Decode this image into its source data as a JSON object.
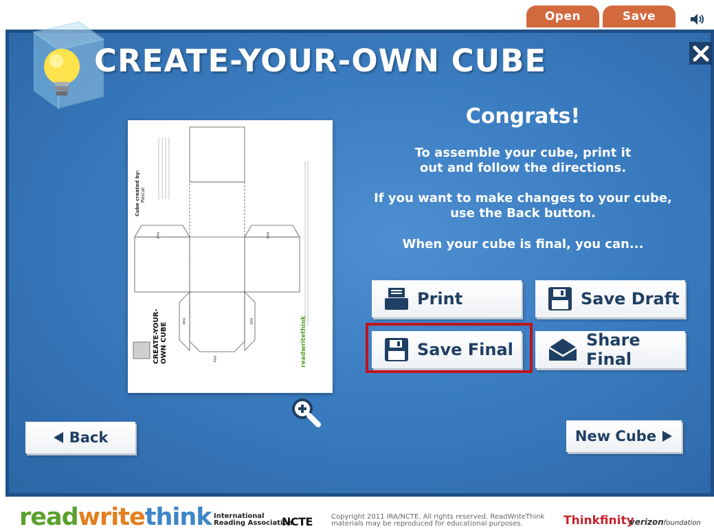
{
  "top_tabs": {
    "open_label": "Open",
    "save_label": "Save"
  },
  "title": "CREATE-YOUR-OWN CUBE",
  "preview": {
    "created_by_label": "Cube created by:",
    "author": "Pascal",
    "instructions": "Cut along the outside edges of your Cube. Then, fold along the dotted lines, making sure that your typed information stays on the outside. Tape the sides together to make a cube.",
    "fold_label": "fold",
    "title_line1": "CREATE-YOUR-",
    "title_line2": "OWN CUBE",
    "brand": "readwritethink"
  },
  "message": {
    "congrats": "Congrats!",
    "line1a": "To assemble your cube, print it",
    "line1b": "out and follow the directions.",
    "line2a": "If you want to make changes to your cube,",
    "line2b": "use the Back button.",
    "line3": "When your cube is final, you can..."
  },
  "actions": {
    "print": "Print",
    "save_draft": "Save Draft",
    "save_final": "Save Final",
    "share_final": "Share Final"
  },
  "nav": {
    "back": "Back",
    "new_cube": "New Cube"
  },
  "footer": {
    "logo_read": "read",
    "logo_write": "write",
    "logo_think": "think",
    "ira_line1": "International",
    "ira_line2": "Reading Association",
    "ncte": "NCTE",
    "copyright_line1": "Copyright 2011 IRA/NCTE. All rights reserved. ReadWriteThink",
    "copyright_line2": "materials may be reproduced for educational purposes.",
    "thinkfinity": "Thinkfinity",
    "verizon": "verizon",
    "foundation": "foundation"
  },
  "colors": {
    "panel": "#3a7cc0",
    "tab": "#d36a3e",
    "button_text": "#1f3f63",
    "highlight": "#c0141b"
  },
  "icons": [
    "speaker-icon",
    "close-icon",
    "lightbulb-cube-icon",
    "zoom-in-icon",
    "printer-icon",
    "floppy-disk-icon",
    "envelope-icon",
    "arrow-left-icon",
    "arrow-right-icon"
  ]
}
